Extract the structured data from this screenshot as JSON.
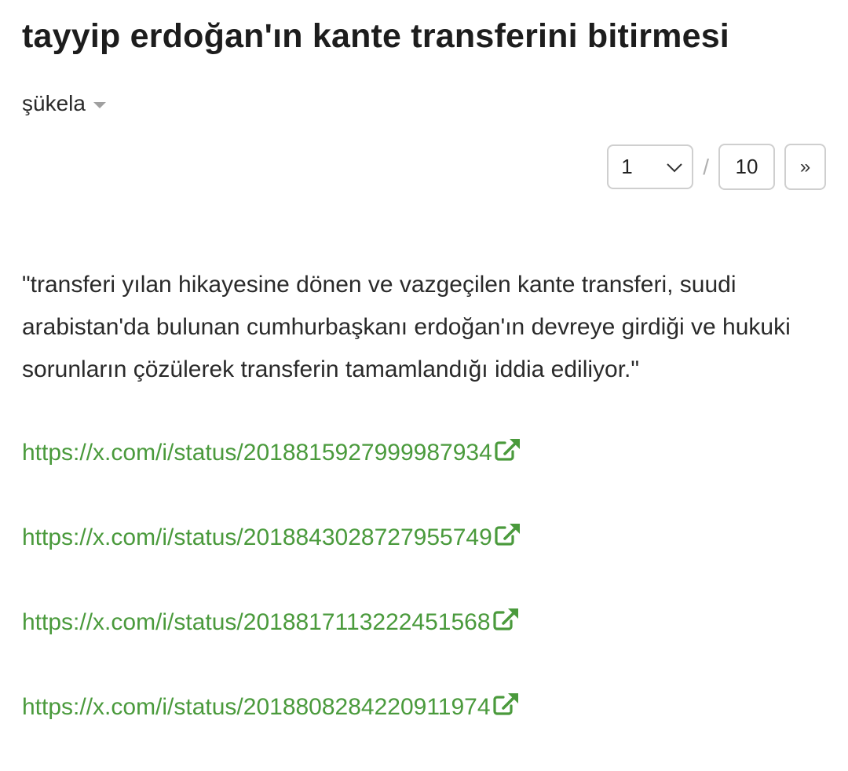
{
  "topic": {
    "title": "tayyip erdoğan'ın kante transferini bitirmesi"
  },
  "sort": {
    "label": "şükela"
  },
  "pager": {
    "current_page": "1",
    "separator": "/",
    "total_pages": "10",
    "next_label": "»"
  },
  "entry": {
    "text": "\"transferi yılan hikayesine dönen ve vazgeçilen kante transferi, suudi arabistan'da bulunan cumhurbaşkanı erdoğan'ın devreye girdiği ve hukuki sorunların çözülerek transferin tamamlandığı iddia ediliyor.\"",
    "links": [
      "https://x.com/i/status/2018815927999987934",
      "https://x.com/i/status/2018843028727955749",
      "https://x.com/i/status/2018817113222451568",
      "https://x.com/i/status/2018808284220911974"
    ]
  },
  "colors": {
    "link": "#4a9a3c",
    "text": "#2a2a2a",
    "border": "#cfcfcf"
  },
  "icons": {
    "sort_caret": "caret-down-icon",
    "page_select": "chevron-down-icon",
    "external_link": "external-link-icon"
  }
}
